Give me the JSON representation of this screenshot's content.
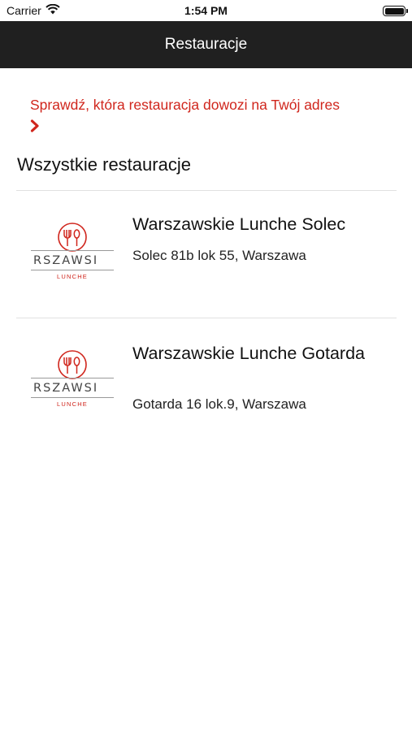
{
  "status_bar": {
    "carrier": "Carrier",
    "time": "1:54 PM"
  },
  "nav": {
    "title": "Restauracje"
  },
  "delivery_link": {
    "label": "Sprawdź, która restauracja dowozi na Twój adres"
  },
  "section": {
    "title": "Wszystkie restauracje"
  },
  "restaurants": [
    {
      "name": "Warszawskie Lunche Solec",
      "address": "Solec 81b lok 55, Warszawa",
      "logo_word": "RSZAWSI",
      "logo_sub": "LUNCHE"
    },
    {
      "name": "Warszawskie Lunche Gotarda",
      "address": "Gotarda 16 lok.9, Warszawa",
      "logo_word": "RSZAWSI",
      "logo_sub": "LUNCHE"
    }
  ],
  "colors": {
    "accent": "#d0261d",
    "nav_background": "#202020",
    "divider": "#e1e1e1"
  }
}
